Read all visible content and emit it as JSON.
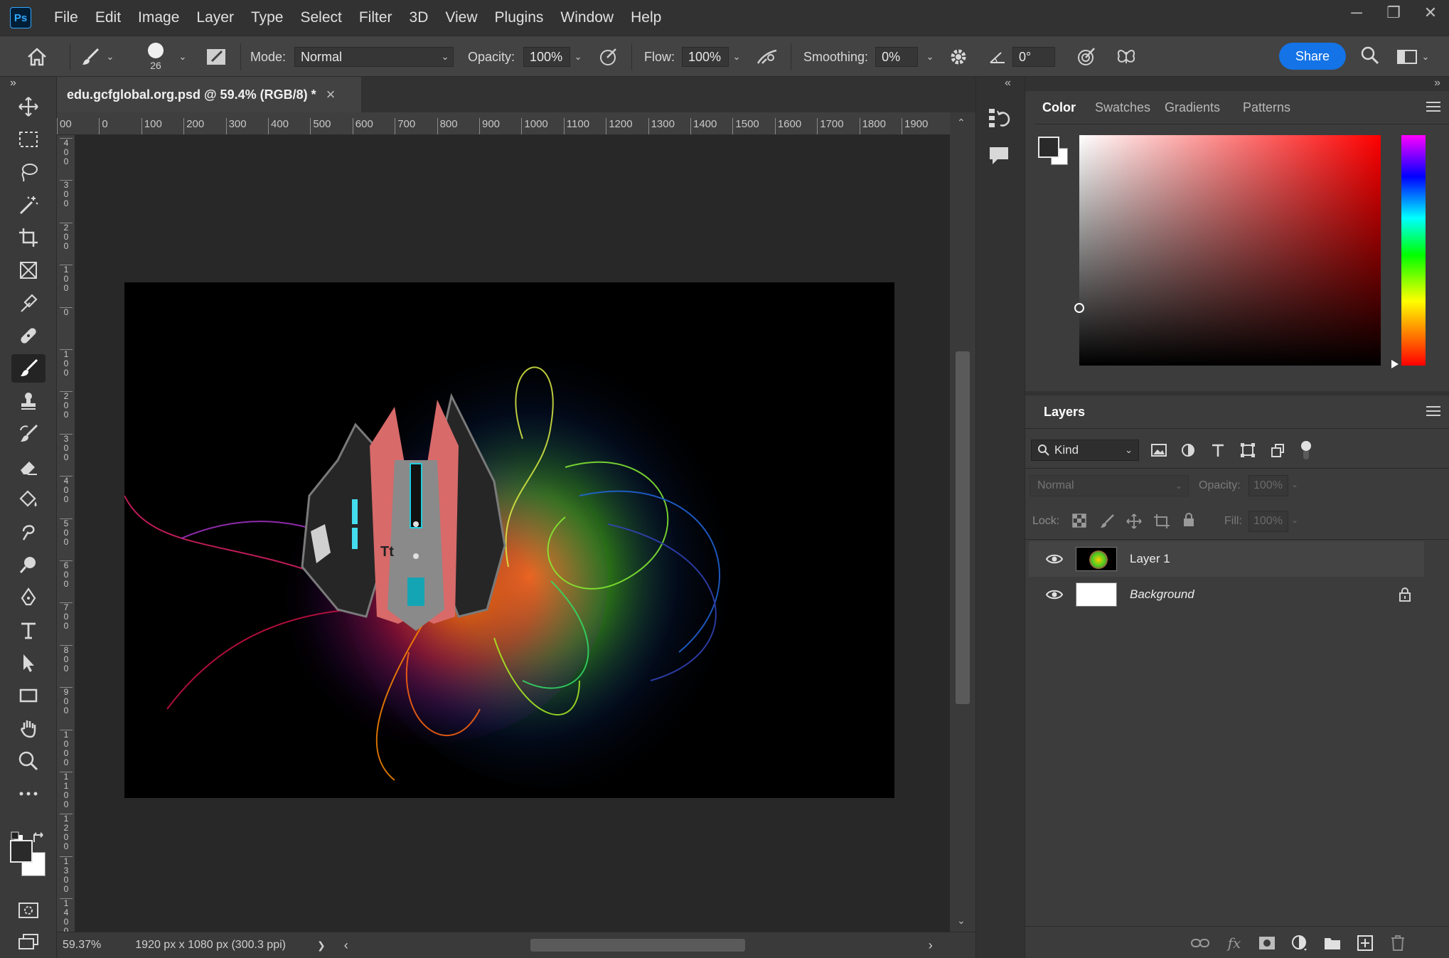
{
  "app": {
    "logo": "Ps"
  },
  "menu": [
    "File",
    "Edit",
    "Image",
    "Layer",
    "Type",
    "Select",
    "Filter",
    "3D",
    "View",
    "Plugins",
    "Window",
    "Help"
  ],
  "window_controls": {
    "minimize": "─",
    "restore": "❐",
    "close": "✕"
  },
  "options": {
    "brush_size": "26",
    "mode_label": "Mode:",
    "mode_value": "Normal",
    "opacity_label": "Opacity:",
    "opacity_value": "100%",
    "flow_label": "Flow:",
    "flow_value": "100%",
    "smoothing_label": "Smoothing:",
    "smoothing_value": "0%",
    "angle_value": "0°",
    "share_label": "Share"
  },
  "document": {
    "tab_title": "edu.gcfglobal.org.psd @ 59.4% (RGB/8) *",
    "close_glyph": "×",
    "ruler_top": [
      "00",
      "0",
      "100",
      "200",
      "300",
      "400",
      "500",
      "600",
      "700",
      "800",
      "900",
      "1000",
      "1100",
      "1200",
      "1300",
      "1400",
      "1500",
      "1600",
      "1700",
      "1800",
      "1900"
    ],
    "ruler_left": [
      "4\n0\n0",
      "3\n0\n0",
      "2\n0\n0",
      "1\n0\n0",
      "0",
      "1\n0\n0",
      "2\n0\n0",
      "3\n0\n0",
      "4\n0\n0",
      "5\n0\n0",
      "6\n0\n0",
      "7\n0\n0",
      "8\n0\n0",
      "9\n0\n0",
      "1\n0\n0\n0",
      "1\n1\n0\n0",
      "1\n2\n0\n0",
      "1\n3\n0\n0",
      "1\n4\n0\n0"
    ],
    "artwork_text": "Tt"
  },
  "status": {
    "zoom": "59.37%",
    "doc_info": "1920 px x 1080 px (300.3 ppi)",
    "arrow": "❯"
  },
  "color_panel": {
    "tabs": [
      "Color",
      "Swatches",
      "Gradients",
      "Patterns"
    ],
    "active_tab": "Color"
  },
  "layers_panel": {
    "title": "Layers",
    "filter_label": "Kind",
    "blend_mode": "Normal",
    "opacity_label": "Opacity:",
    "opacity_value": "100%",
    "lock_label": "Lock:",
    "fill_label": "Fill:",
    "fill_value": "100%",
    "layers": [
      {
        "name": "Layer 1",
        "visible": true,
        "locked": false,
        "italic": false
      },
      {
        "name": "Background",
        "visible": true,
        "locked": true,
        "italic": true
      }
    ]
  },
  "colors": {
    "accent": "#1473e6",
    "panel_bg": "#3c3c3c",
    "menubar_bg": "#323232",
    "canvas_bg": "#282828"
  }
}
